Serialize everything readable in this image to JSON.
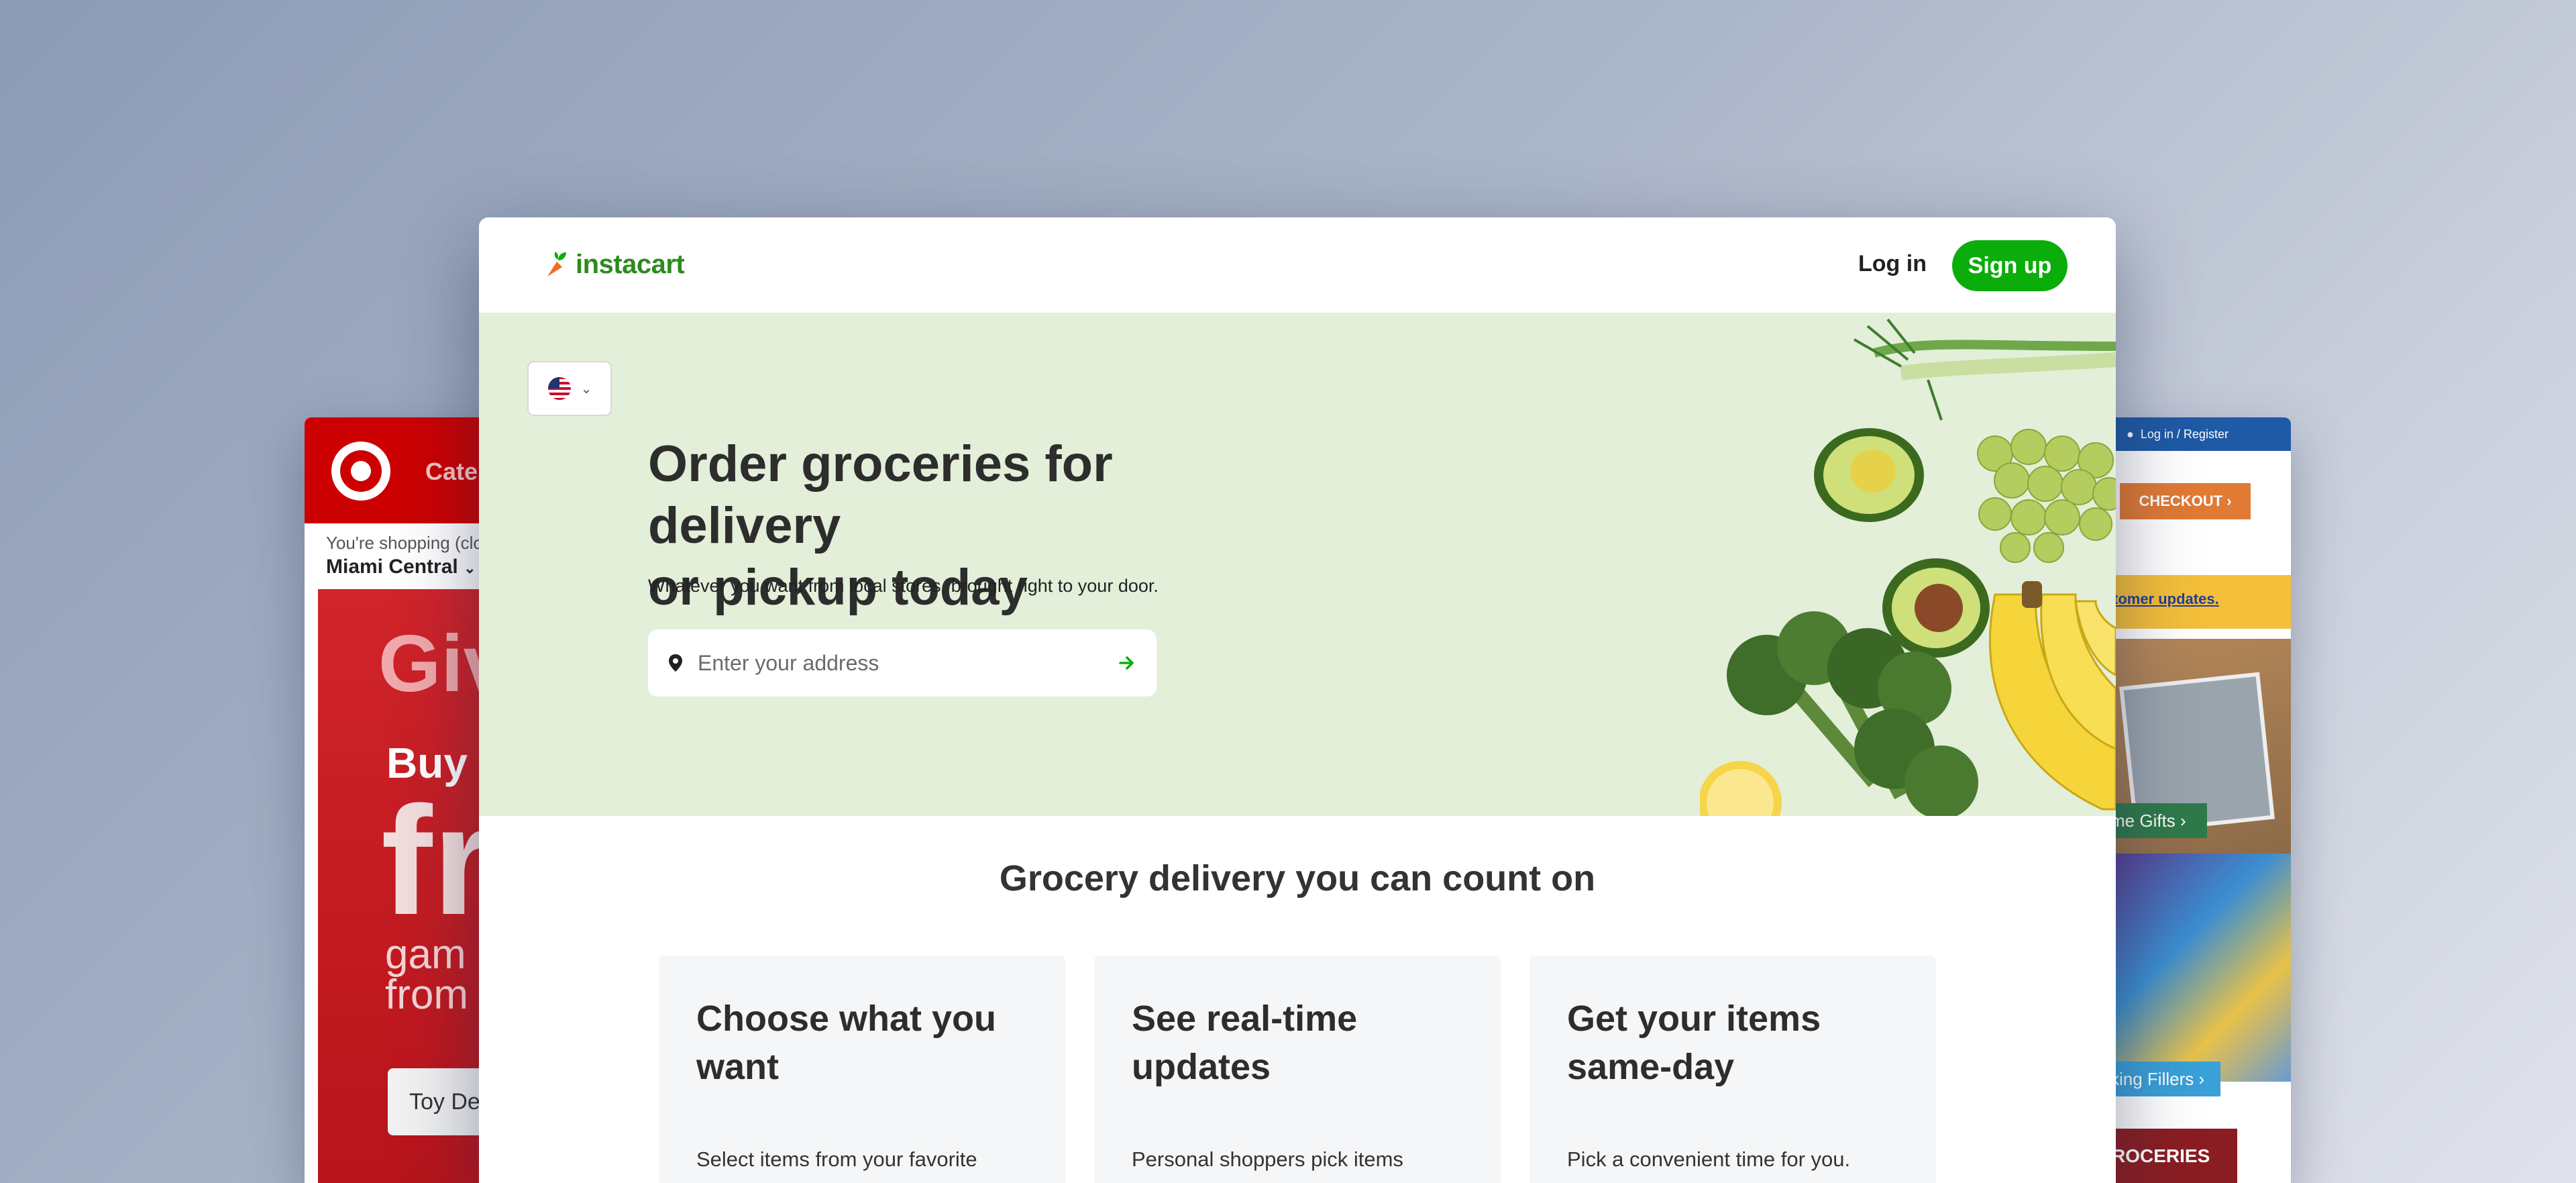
{
  "target": {
    "nav_label": "Cate",
    "shopping_note": "You're shopping (clo",
    "store_name": "Miami Central",
    "promo_headline": "Giv",
    "promo_buy": "Buy",
    "promo_big": "fr",
    "promo_line1": "gam",
    "promo_line2": "from",
    "button_label": "Toy De"
  },
  "right_site": {
    "login_label": "Log in / Register",
    "checkout_label": "CHECKOUT",
    "updates_label": "tomer updates.",
    "gifts_label": "me Gifts",
    "fillers_label": "king Fillers",
    "groceries_label": "ROCERIES"
  },
  "instacart": {
    "brand": "instacart",
    "login": "Log in",
    "signup": "Sign up",
    "locale_icon": "us-flag-icon",
    "hero": {
      "title_line1": "Order groceries for delivery",
      "title_line2": "or pickup today",
      "subtitle": "Whatever you want from local stores, brought right to your door.",
      "address_placeholder": "Enter your address"
    },
    "section_title": "Grocery delivery you can count on",
    "features": [
      {
        "title": "Choose what you want",
        "text": "Select items from your favorite"
      },
      {
        "title": "See real-time updates",
        "text": "Personal shoppers pick items"
      },
      {
        "title": "Get your items same-day",
        "text": "Pick a convenient time for you."
      }
    ]
  },
  "colors": {
    "instacart_green": "#0aad0a",
    "hero_bg": "#e3efd9",
    "target_red": "#cc0000"
  }
}
